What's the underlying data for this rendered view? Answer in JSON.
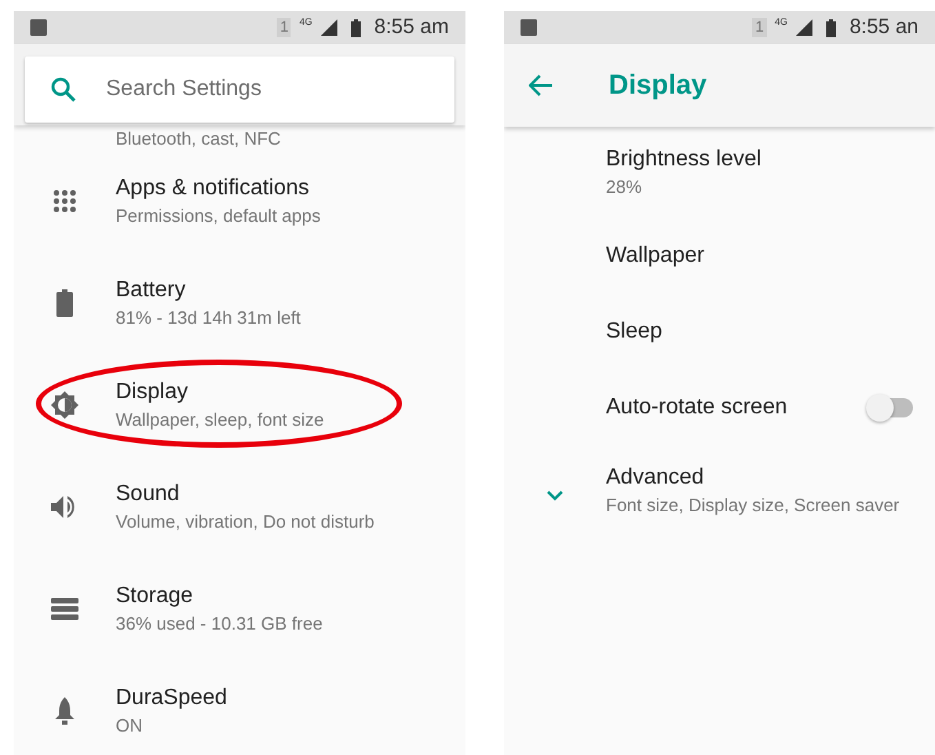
{
  "screens": [
    {
      "status_bar": {
        "sim": "1",
        "network": "4G",
        "time": "8:55 am"
      },
      "search": {
        "placeholder": "Search Settings"
      },
      "partial_subtitle": "Bluetooth, cast, NFC",
      "items": [
        {
          "title": "Apps & notifications",
          "subtitle": "Permissions, default apps",
          "kind": "apps",
          "highlighted": false
        },
        {
          "title": "Battery",
          "subtitle": "81% - 13d 14h 31m left",
          "kind": "battery",
          "highlighted": false
        },
        {
          "title": "Display",
          "subtitle": "Wallpaper, sleep, font size",
          "kind": "brightness",
          "highlighted": true
        },
        {
          "title": "Sound",
          "subtitle": "Volume, vibration, Do not disturb",
          "kind": "sound",
          "highlighted": false
        },
        {
          "title": "Storage",
          "subtitle": "36% used - 10.31 GB free",
          "kind": "storage",
          "highlighted": false
        },
        {
          "title": "DuraSpeed",
          "subtitle": "ON",
          "kind": "rocket",
          "highlighted": false
        }
      ]
    },
    {
      "status_bar": {
        "sim": "1",
        "network": "4G",
        "time": "8:55 an"
      },
      "header": {
        "title": "Display"
      },
      "items": [
        {
          "kind": "text",
          "title": "Brightness level",
          "subtitle": "28%"
        },
        {
          "kind": "text",
          "title": "Wallpaper"
        },
        {
          "kind": "text",
          "title": "Sleep"
        },
        {
          "kind": "toggle",
          "title": "Auto-rotate screen",
          "on": false
        },
        {
          "kind": "expand",
          "title": "Advanced",
          "subtitle": "Font size, Display size, Screen saver",
          "expanded": false
        }
      ]
    }
  ]
}
